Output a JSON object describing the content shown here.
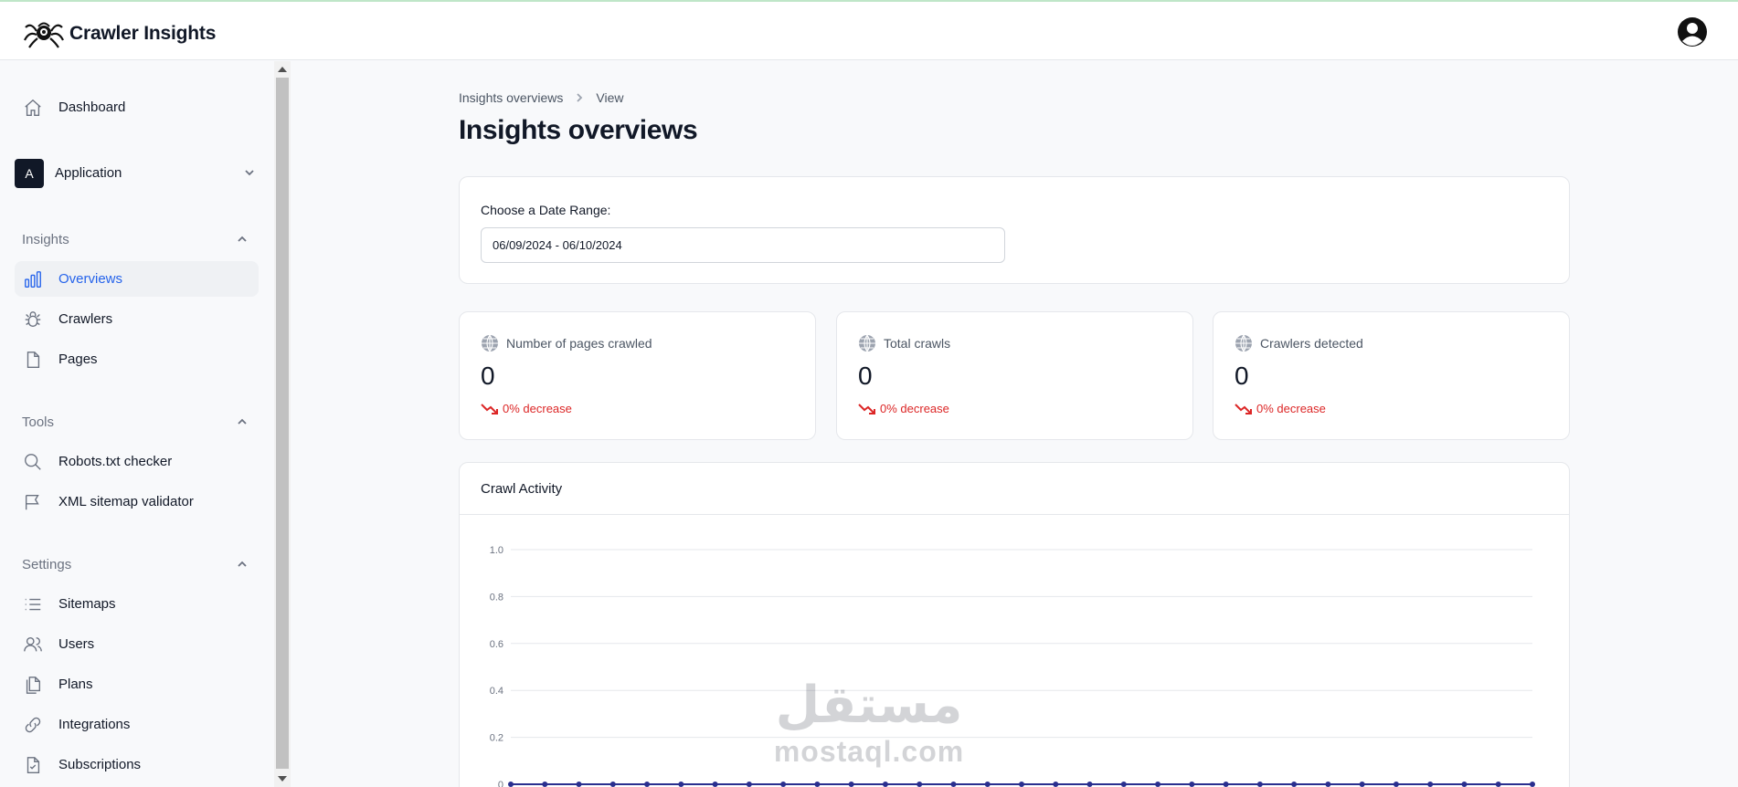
{
  "app": {
    "name": "Crawler Insights"
  },
  "sidebar": {
    "dashboard": "Dashboard",
    "application": {
      "badge": "A",
      "label": "Application"
    },
    "insights": {
      "title": "Insights",
      "items": [
        "Overviews",
        "Crawlers",
        "Pages"
      ]
    },
    "tools": {
      "title": "Tools",
      "items": [
        "Robots.txt checker",
        "XML sitemap validator"
      ]
    },
    "settings": {
      "title": "Settings",
      "items": [
        "Sitemaps",
        "Users",
        "Plans",
        "Integrations",
        "Subscriptions"
      ]
    }
  },
  "breadcrumb": [
    "Insights overviews",
    "View"
  ],
  "page_title": "Insights overviews",
  "date_range": {
    "label": "Choose a Date Range:",
    "value": "06/09/2024 - 06/10/2024"
  },
  "stats": [
    {
      "title": "Number of pages crawled",
      "value": "0",
      "change": "0% decrease"
    },
    {
      "title": "Total crawls",
      "value": "0",
      "change": "0% decrease"
    },
    {
      "title": "Crawlers detected",
      "value": "0",
      "change": "0% decrease"
    }
  ],
  "chart_title": "Crawl Activity",
  "chart_data": {
    "type": "line",
    "title": "",
    "xlabel": "",
    "ylabel": "",
    "ylim": [
      0,
      1.0
    ],
    "yticks": [
      "1.0",
      "0.8",
      "0.6",
      "0.4",
      "0.2",
      "0"
    ],
    "grid": true,
    "series": [
      {
        "values": [
          0,
          0,
          0,
          0,
          0,
          0,
          0,
          0,
          0,
          0,
          0,
          0,
          0,
          0,
          0,
          0,
          0,
          0,
          0,
          0,
          0,
          0,
          0,
          0,
          0,
          0,
          0,
          0,
          0,
          0,
          0
        ]
      }
    ],
    "color": "#2a2f8f"
  },
  "watermark": {
    "arabic": "مستقل",
    "latin": "mostaql.com"
  },
  "colors": {
    "accent": "#2563eb",
    "decrease": "#dc2626"
  }
}
